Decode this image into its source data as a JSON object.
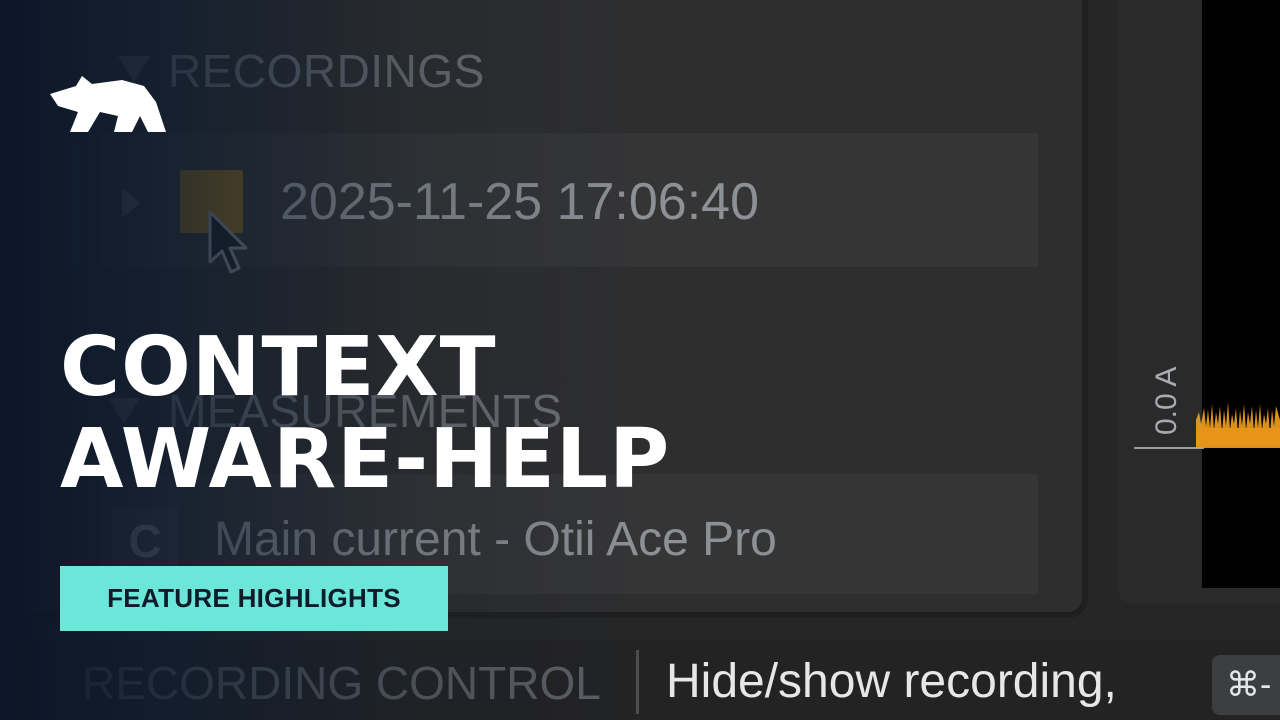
{
  "recordings": {
    "header": "RECORDINGS",
    "item_timestamp": "2025-11-25 17:06:40",
    "swatch_color": "#8b6a1d"
  },
  "measurements": {
    "header": "MEASUREMENTS",
    "badge": "C",
    "item_name": "Main current - Otii Ace Pro"
  },
  "graph": {
    "axis_label": "0.0 A",
    "signal_color": "#f0a21e"
  },
  "bottom_bar": {
    "section_label": "RECORDING CONTROL",
    "help_text": "Hide/show recording,",
    "shortcut": "⌘-"
  },
  "overlay": {
    "headline_line1": "CONTEXT",
    "headline_line2": "AWARE-HELP",
    "tag_label": "FEATURE HIGHLIGHTS",
    "tag_color": "#6de6da",
    "logo_icon": "bear-logo-icon"
  }
}
